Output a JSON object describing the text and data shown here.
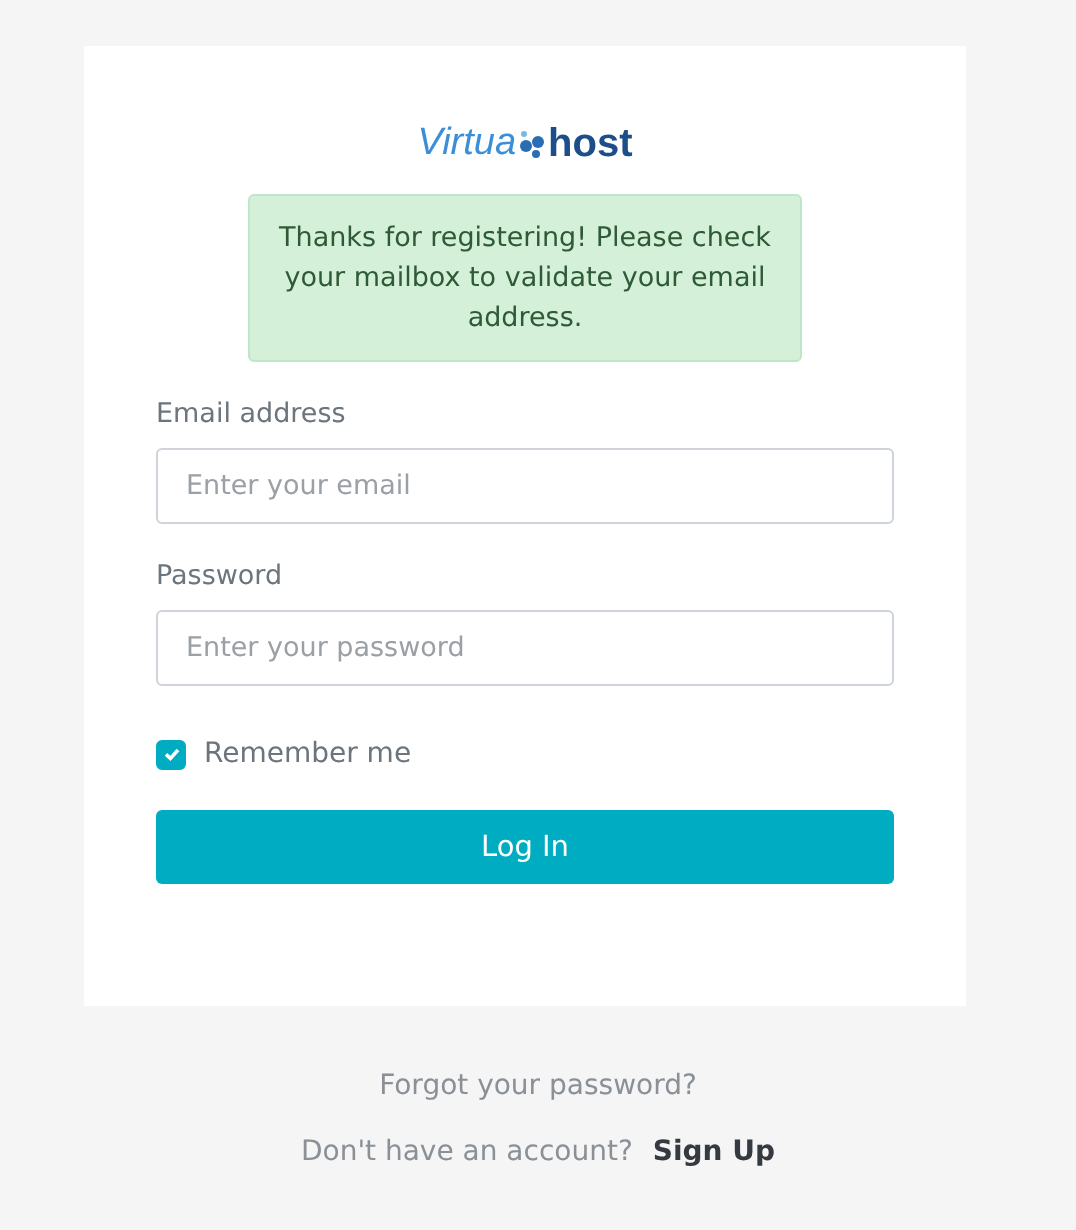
{
  "logo": {
    "part_1": "Virtua",
    "part_2": "host"
  },
  "alert": {
    "text": "Thanks for registering! Please check your mailbox to validate your email address."
  },
  "fields": [
    {
      "label": "Email address",
      "placeholder": "Enter your email"
    },
    {
      "label": "Password",
      "placeholder": "Enter your password"
    }
  ],
  "remember": {
    "label": "Remember me",
    "checked": true
  },
  "login_button": "Log In",
  "forgot_link": "Forgot your password?",
  "signup": {
    "text": "Don't have an account?",
    "link": "Sign Up"
  }
}
